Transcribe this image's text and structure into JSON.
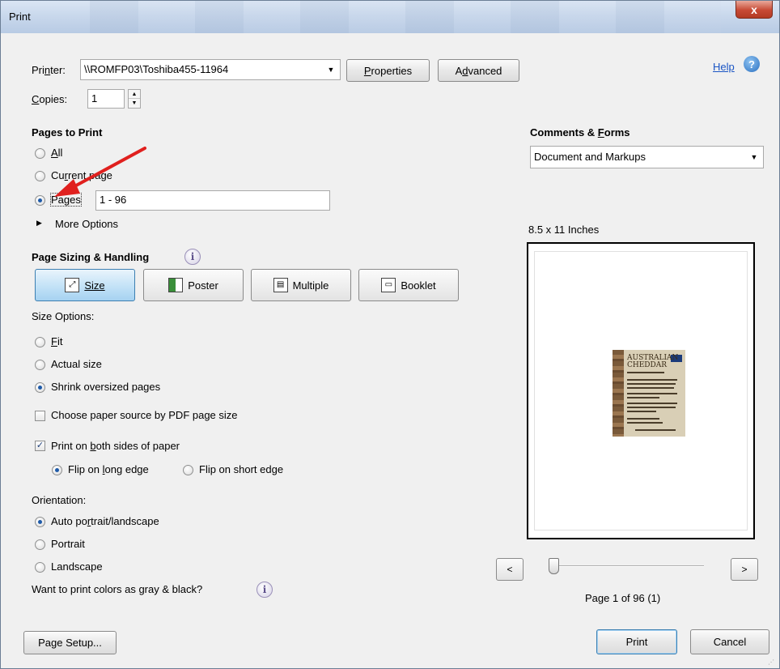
{
  "window": {
    "title": "Print",
    "close_glyph": "x"
  },
  "printer": {
    "label_pre": "Pri",
    "label_mnemonic": "n",
    "label_post": "ter:",
    "value": "\\\\ROMFP03\\Toshiba455-11964",
    "properties_pre": "",
    "properties_mnemonic": "P",
    "properties_post": "roperties",
    "advanced_pre": "A",
    "advanced_mnemonic": "d",
    "advanced_post": "vanced"
  },
  "help": {
    "label": "Help",
    "icon": "question-icon"
  },
  "copies": {
    "label_mnemonic": "C",
    "label_post": "opies:",
    "value": "1"
  },
  "pages_to_print": {
    "heading": "Pages to Print",
    "all": {
      "mnemonic": "A",
      "rest": "ll"
    },
    "current": {
      "pre": "Cu",
      "mnemonic": "r",
      "post": "rent page"
    },
    "pages": {
      "pre": "Pa",
      "mnemonic": "g",
      "post": "es",
      "value": "1 - 96"
    },
    "more_options": "More Options"
  },
  "comments_forms": {
    "heading_pre": "Comments & ",
    "heading_mnemonic": "F",
    "heading_post": "orms",
    "value": "Document and Markups"
  },
  "page_sizing": {
    "heading": "Page Sizing & Handling",
    "tiles": {
      "size": "Size",
      "poster": "Poster",
      "multiple": "Multiple",
      "booklet": "Booklet"
    },
    "size_options_label": "Size Options:",
    "fit": {
      "mnemonic": "F",
      "rest": "it"
    },
    "actual_size": "Actual size",
    "shrink": "Shrink oversized pages",
    "paper_source": "Choose paper source by PDF page size",
    "both_sides_pre": "Print on ",
    "both_sides_mnemonic": "b",
    "both_sides_post": "oth sides of paper",
    "flip_long_pre": "Flip on ",
    "flip_long_mnemonic": "l",
    "flip_long_post": "ong edge",
    "flip_short": "Flip on short edge"
  },
  "orientation": {
    "label": "Orientation:",
    "auto_pre": "Auto po",
    "auto_mnemonic": "r",
    "auto_post": "trait/landscape",
    "portrait": "Portrait",
    "landscape": "Landscape"
  },
  "gray_question": "Want to print colors as gray & black?",
  "preview": {
    "paper_size": "8.5 x 11 Inches",
    "thumb_title_1": "AUSTRALIAN",
    "thumb_title_2": "CHEDDAR",
    "page_status": "Page 1 of 96 (1)",
    "page_fraction": 0.0,
    "prev_label": "<",
    "next_label": ">"
  },
  "footer": {
    "page_setup_pre": "Pa",
    "page_setup_mnemonic": "g",
    "page_setup_post": "e Setup...",
    "print_label": "Print",
    "cancel_label": "Cancel"
  },
  "colors": {
    "accent": "#1e5aa8",
    "annotation_arrow": "#e0201e"
  }
}
